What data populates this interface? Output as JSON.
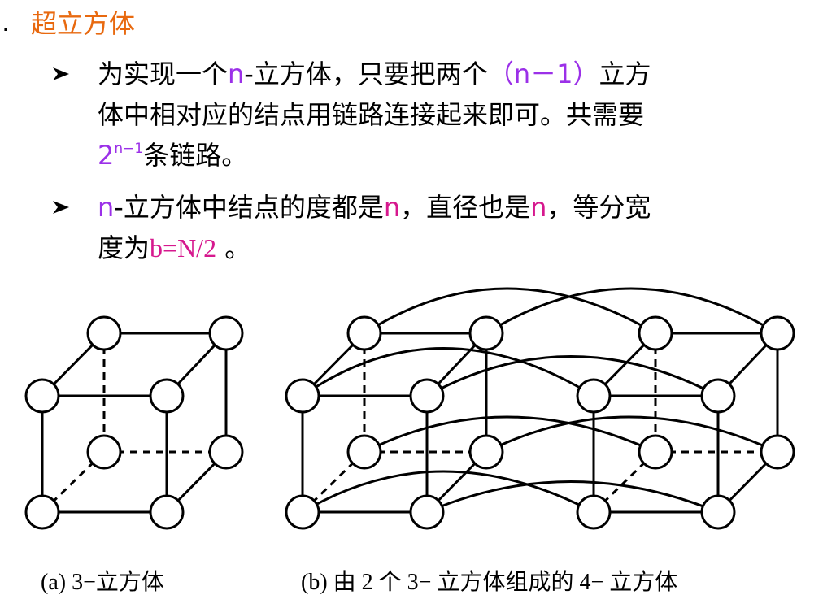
{
  "section": {
    "number_dot": ".",
    "title": "超立方体"
  },
  "bullets": [
    {
      "line1_pre": "为实现一个",
      "line1_n": "n",
      "line1_mid": "-立方体，只要把两个",
      "line1_paren": "（n－1）",
      "line1_post": "立方",
      "line2": "体中相对应的结点用链路连接起来即可。共需要",
      "line3_base": "2",
      "line3_exp": "n−1",
      "line3_post": "条链路。"
    },
    {
      "l1_n": "n",
      "l1_a": "-立方体中结点的度都是",
      "l1_n2": "n",
      "l1_b": "，直径也是",
      "l1_n3": "n",
      "l1_c": "，等分宽",
      "l2_a": "度为",
      "l2_formula": "b=N/2",
      "l2_b": " 。"
    }
  ],
  "figure": {
    "caption_a": "(a) 3−立方体",
    "caption_b": "(b) 由 2 个 3− 立方体组成的 4− 立方体"
  },
  "colors": {
    "title": "#e8690f",
    "violet": "#9b30e8",
    "magenta": "#d6188e"
  }
}
